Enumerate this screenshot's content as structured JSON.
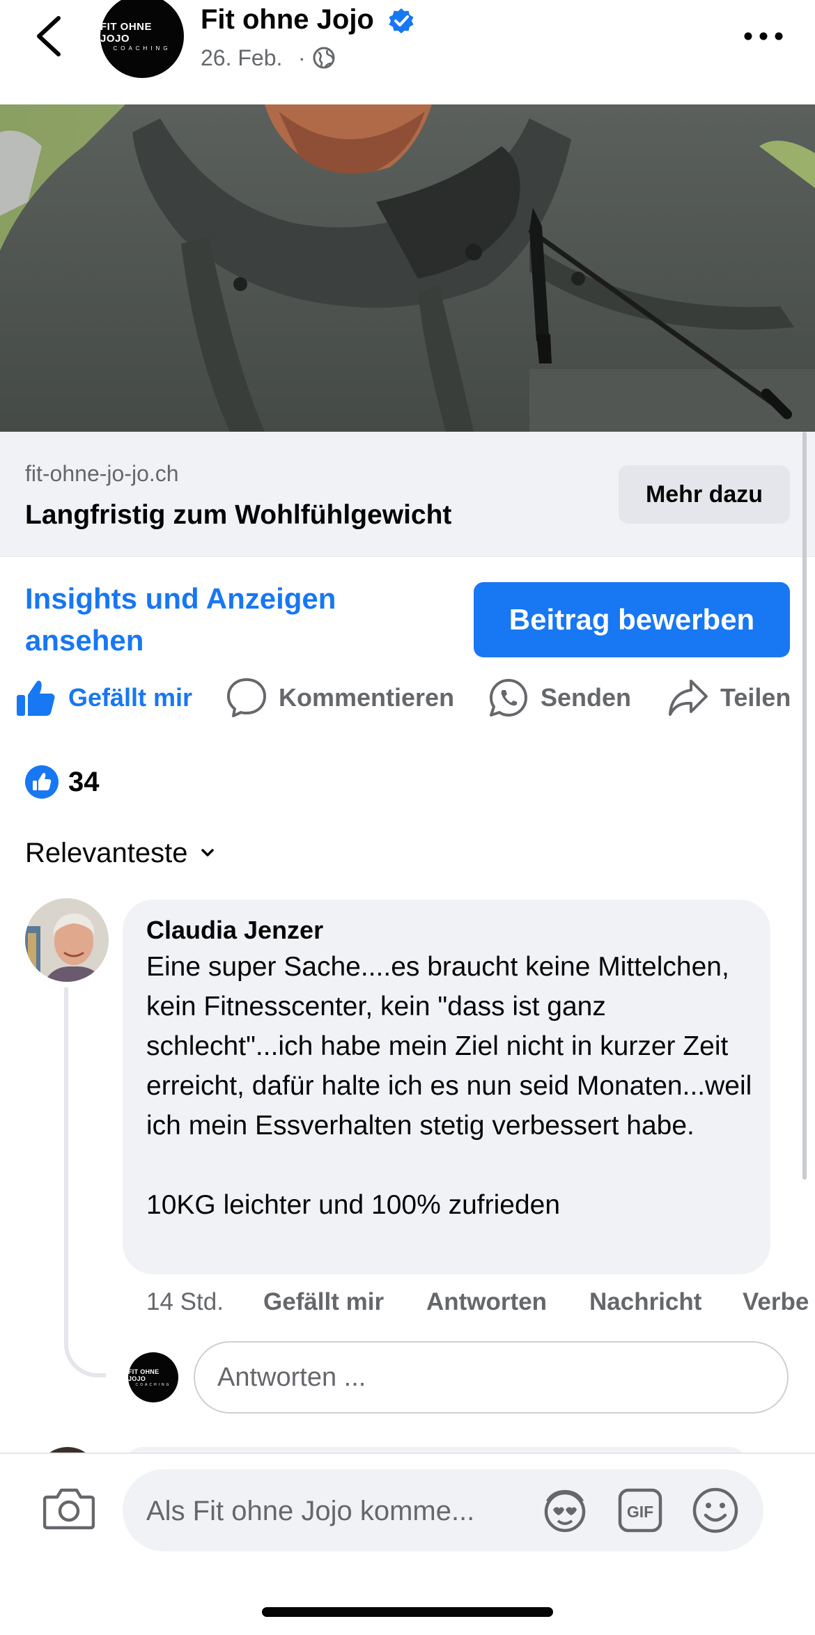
{
  "header": {
    "page_name": "Fit ohne Jojo",
    "logo_main": "FIT OHNE JOJO",
    "logo_sub": "COACHING",
    "date": "26. Feb.",
    "separator": "·",
    "icons": {
      "back": "chevron-left-icon",
      "verified": "verified-badge-icon",
      "privacy": "globe-icon",
      "more": "more-dots-icon"
    }
  },
  "link_preview": {
    "domain": "fit-ohne-jo-jo.ch",
    "title": "Langfristig zum Wohlfühlgewicht",
    "cta_label": "Mehr dazu"
  },
  "insights": {
    "link_label": "Insights und Anzeigen ansehen",
    "promote_label": "Beitrag bewerben"
  },
  "actions": [
    {
      "label": "Gefällt mir",
      "icon": "thumbs-up-icon",
      "active": true
    },
    {
      "label": "Kommentieren",
      "icon": "comment-bubble-icon",
      "active": false
    },
    {
      "label": "Senden",
      "icon": "whatsapp-icon",
      "active": false
    },
    {
      "label": "Teilen",
      "icon": "share-arrow-icon",
      "active": false
    }
  ],
  "reactions": {
    "count": "34",
    "icon": "like-reaction-icon"
  },
  "sort": {
    "label": "Relevanteste",
    "icon": "chevron-down-icon"
  },
  "comment": {
    "author": "Claudia Jenzer",
    "text": "Eine super Sache....es braucht keine Mittelchen, kein Fitnesscenter, kein \"dass ist ganz schlecht\"...ich habe mein Ziel nicht in kurzer Zeit erreicht, dafür halte ich es nun seid Monaten...weil ich mein Essverhalten stetig verbessert habe.\n\n10KG leichter und 100% zufrieden",
    "time": "14 Std.",
    "like_label": "Gefällt mir",
    "reply_label": "Antworten",
    "message_label": "Nachricht",
    "hide_label": "Verbe"
  },
  "reply": {
    "placeholder": "Antworten ..."
  },
  "composer": {
    "placeholder": "Als Fit ohne Jojo komme...",
    "icons": {
      "camera": "camera-icon",
      "sticker": "sticker-icon",
      "gif": "gif-icon",
      "emoji": "emoji-icon"
    },
    "gif_label": "GIF"
  },
  "colors": {
    "accent": "#1877f2",
    "secondary_text": "#65676b",
    "surface": "#f0f2f5"
  }
}
